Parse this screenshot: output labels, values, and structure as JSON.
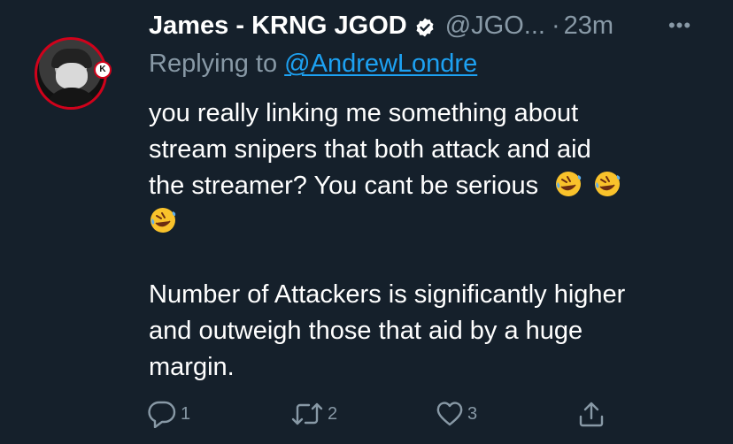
{
  "tweet": {
    "author_name": "James - KRNG JGOD",
    "handle": "@JGO...",
    "separator": "·",
    "time": "23m",
    "more": "•••",
    "replying_prefix": "Replying to ",
    "replying_to": "@AndrewLondre",
    "text_lines": [
      "you really linking me something about",
      "stream snipers that both attack and aid",
      "the streamer? You cant be serious"
    ],
    "paragraph2_lines": [
      "Number of Attackers is significantly higher",
      "and outweigh those that aid by a huge",
      "margin."
    ],
    "emoji": "rolling-on-the-floor-laughing",
    "avatar_badge": "K"
  },
  "actions": {
    "reply_count": "1",
    "retweet_count": "2",
    "like_count": "3"
  },
  "colors": {
    "background": "#15202b",
    "text": "#ffffff",
    "secondary": "#8899a6",
    "link": "#1da1f2",
    "avatar_ring": "#d0021b"
  }
}
